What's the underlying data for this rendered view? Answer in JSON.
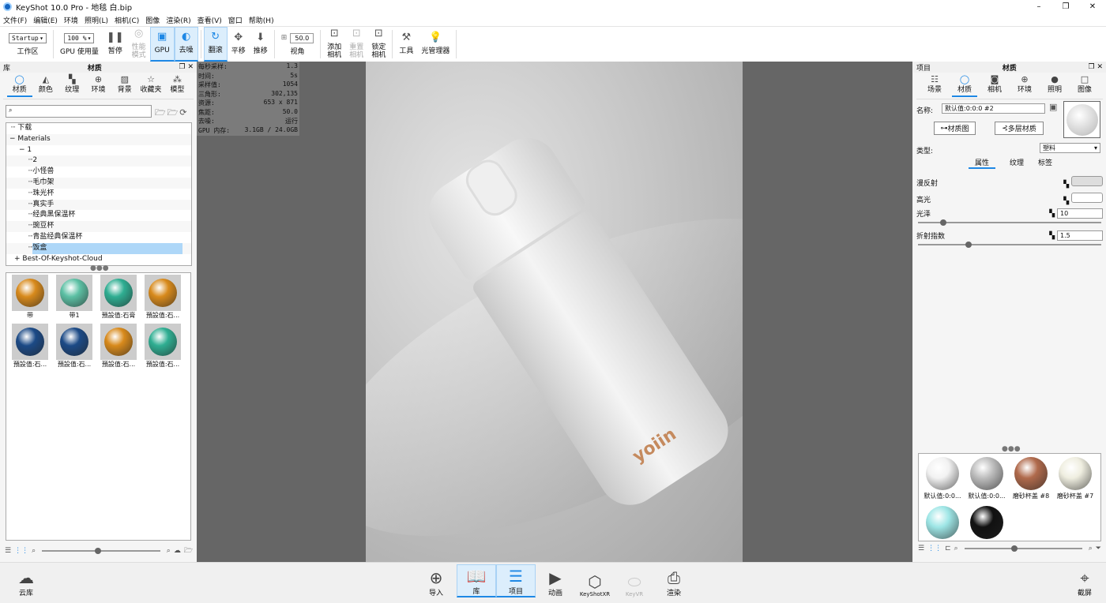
{
  "app": {
    "title": "KeyShot 10.0 Pro  - 地毯 白.bip",
    "win": [
      "–",
      "❐",
      "✕"
    ]
  },
  "menu": [
    "文件(F)",
    "编辑(E)",
    "环境",
    "照明(L)",
    "相机(C)",
    "图像",
    "渲染(R)",
    "查看(V)",
    "窗口",
    "帮助(H)"
  ],
  "toolbar": {
    "workspace_value": "Startup",
    "workspace_label": "工作区",
    "gpu_usage_value": "100 %",
    "gpu_usage_label": "GPU 使用量",
    "pause": "暂停",
    "perf_mode": "性能\n模式",
    "gpu": "GPU",
    "denoise": "去噪",
    "tumble": "翻滚",
    "pan": "平移",
    "dolly": "推移",
    "fov_value": "50.0",
    "fov_label": "视角",
    "add_camera": "添加\n相机",
    "reset_camera": "重置\n相机",
    "lock_camera": "锁定\n相机",
    "tools": "工具",
    "light_manager": "光管理器"
  },
  "library": {
    "header": "库",
    "title": "材质",
    "tabs": [
      "材质",
      "颜色",
      "纹理",
      "环境",
      "背景",
      "收藏夹",
      "模型"
    ],
    "search_placeholder": "",
    "tree": [
      "下载",
      "Materials",
      "1",
      "2",
      "小怪兽",
      "毛巾架",
      "珠光杯",
      "真实手",
      "经典黑保温杯",
      "豌豆杯",
      "青盐经典保温杯",
      "饭盒",
      "Best-Of-Keyshot-Cloud"
    ],
    "thumbs": [
      {
        "label": "带",
        "color": "#d88a1c"
      },
      {
        "label": "带1",
        "color": "#5cc0a4"
      },
      {
        "label": "預設值:石膏",
        "color": "#2fae92"
      },
      {
        "label": "預設值:石...",
        "color": "#d88a1c"
      },
      {
        "label": "預設值:石...",
        "color": "#1c4a86"
      },
      {
        "label": "預設值:石...",
        "color": "#1c4a86"
      },
      {
        "label": "預設值:石...",
        "color": "#d88a1c"
      },
      {
        "label": "預設值:石...",
        "color": "#2fae92"
      }
    ]
  },
  "stats": [
    [
      "每秒采样:",
      "1.3"
    ],
    [
      "时间:",
      "5s"
    ],
    [
      "采样值:",
      "1054"
    ],
    [
      "三角形:",
      "302,135"
    ],
    [
      "资源:",
      "653 x 871"
    ],
    [
      "焦距:",
      "50.0"
    ],
    [
      "去噪:",
      "运行"
    ],
    [
      "GPU 内存:",
      "3.1GB / 24.0GB"
    ]
  ],
  "render": {
    "brand": "yoiin"
  },
  "project": {
    "header": "项目",
    "title": "材质",
    "tabs": [
      "场景",
      "材质",
      "相机",
      "环境",
      "照明",
      "图像"
    ],
    "name_label": "名称:",
    "name_value": "默认值:0:0:0 #2",
    "material_graph": "材质图",
    "multi_layer": "多层材质",
    "type_label": "类型:",
    "type_value": "塑料",
    "subtabs": [
      "属性",
      "纹理",
      "标签"
    ],
    "diffuse": "漫反射",
    "specular": "高光",
    "roughness": "光泽",
    "roughness_value": "10",
    "roughness_fraction": 0.12,
    "ior": "折射指数",
    "ior_value": "1.5",
    "ior_fraction": 0.26,
    "materials": [
      {
        "label": "默认值:0:0...",
        "color": "#f2f2f2"
      },
      {
        "label": "默认值:0:0...",
        "color": "#bdbdbd"
      },
      {
        "label": "磨砂杯盖 #8",
        "color": "#b06a4c"
      },
      {
        "label": "磨砂杯盖 #7",
        "color": "#efeee0"
      },
      {
        "label": "",
        "color": "#9ee6e6"
      },
      {
        "label": "",
        "color": "#111111"
      }
    ]
  },
  "bottom": {
    "cloud": "云库",
    "import": "导入",
    "library": "库",
    "project": "项目",
    "animation": "动画",
    "keyshotxr": "KeyShotXR",
    "keyvr": "KeyVR",
    "render": "渲染",
    "screenshot": "截屏"
  }
}
